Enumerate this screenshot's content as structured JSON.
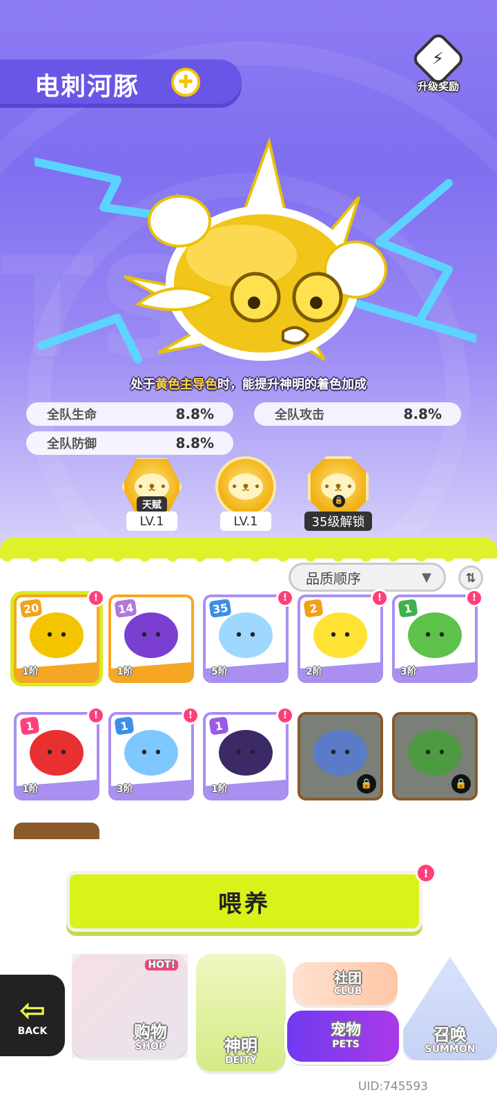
{
  "header": {
    "pet_name": "电刺河豚",
    "attribute_icon": "yellow-cross-icon",
    "upgrade_reward_label": "升级奖励",
    "background_word": "TS"
  },
  "ability": {
    "prefix": "处于",
    "highlight": "黄色主导色",
    "suffix": "时，能提升神明的着色加成",
    "highlight_color": "#ffd43a"
  },
  "stats": [
    {
      "label": "全队生命",
      "value": "8.8%"
    },
    {
      "label": "全队攻击",
      "value": "8.8%"
    },
    {
      "label": "全队防御",
      "value": "8.8%"
    }
  ],
  "skills": [
    {
      "tag": "天赋",
      "level": "LV.1",
      "shape": "hex"
    },
    {
      "level": "LV.1",
      "shape": "round"
    },
    {
      "level": "35级解锁",
      "shape": "oct",
      "locked": true
    }
  ],
  "sort": {
    "label": "品质顺序",
    "chevron_icon": "chevron-down-icon",
    "toggle_icon": "sort-toggle-icon"
  },
  "pets": [
    {
      "badge": "20",
      "grade": "1阶",
      "color": "orange",
      "alert": true,
      "selected": true,
      "art_color": "#f4c400",
      "badge_color": "#f2a11a"
    },
    {
      "badge": "14",
      "grade": "1阶",
      "color": "orange",
      "alert": false,
      "art_color": "#7a3fd1",
      "badge_color": "#b07ad8"
    },
    {
      "badge": "35",
      "grade": "5阶",
      "color": "purple",
      "alert": true,
      "art_color": "#9fd7ff",
      "badge_color": "#3b8fe8"
    },
    {
      "badge": "2",
      "grade": "2阶",
      "color": "purple",
      "alert": true,
      "art_color": "#ffe233",
      "badge_color": "#f2a11a"
    },
    {
      "badge": "1",
      "grade": "3阶",
      "color": "purple",
      "alert": true,
      "art_color": "#5cc24a",
      "badge_color": "#3fb24a"
    },
    {
      "badge": "1",
      "grade": "1阶",
      "color": "purple",
      "alert": true,
      "art_color": "#e93030",
      "badge_color": "#ff3f7a"
    },
    {
      "badge": "1",
      "grade": "3阶",
      "color": "purple",
      "alert": true,
      "art_color": "#7fc7ff",
      "badge_color": "#3b8fe8"
    },
    {
      "badge": "1",
      "grade": "1阶",
      "color": "purple",
      "alert": true,
      "art_color": "#3b2a66",
      "badge_color": "#9a5ae6"
    },
    {
      "badge": "",
      "grade": "",
      "color": "locked",
      "alert": false,
      "locked": true,
      "art_color": "#5a7bc7"
    },
    {
      "badge": "",
      "grade": "",
      "color": "locked",
      "alert": false,
      "locked": true,
      "art_color": "#4d9a42"
    }
  ],
  "feed": {
    "label": "喂养",
    "alert": "!"
  },
  "nav": {
    "back": {
      "label": "BACK"
    },
    "shop": {
      "cn": "购物",
      "en": "SHOP",
      "tag": "HOT!"
    },
    "deity": {
      "cn": "神明",
      "en": "DEITY"
    },
    "club": {
      "cn": "社团",
      "en": "CLUB"
    },
    "pets": {
      "cn": "宠物",
      "en": "PETS"
    },
    "summon": {
      "cn": "召唤",
      "en": "SUMMON"
    }
  },
  "uid": "UID:745593"
}
